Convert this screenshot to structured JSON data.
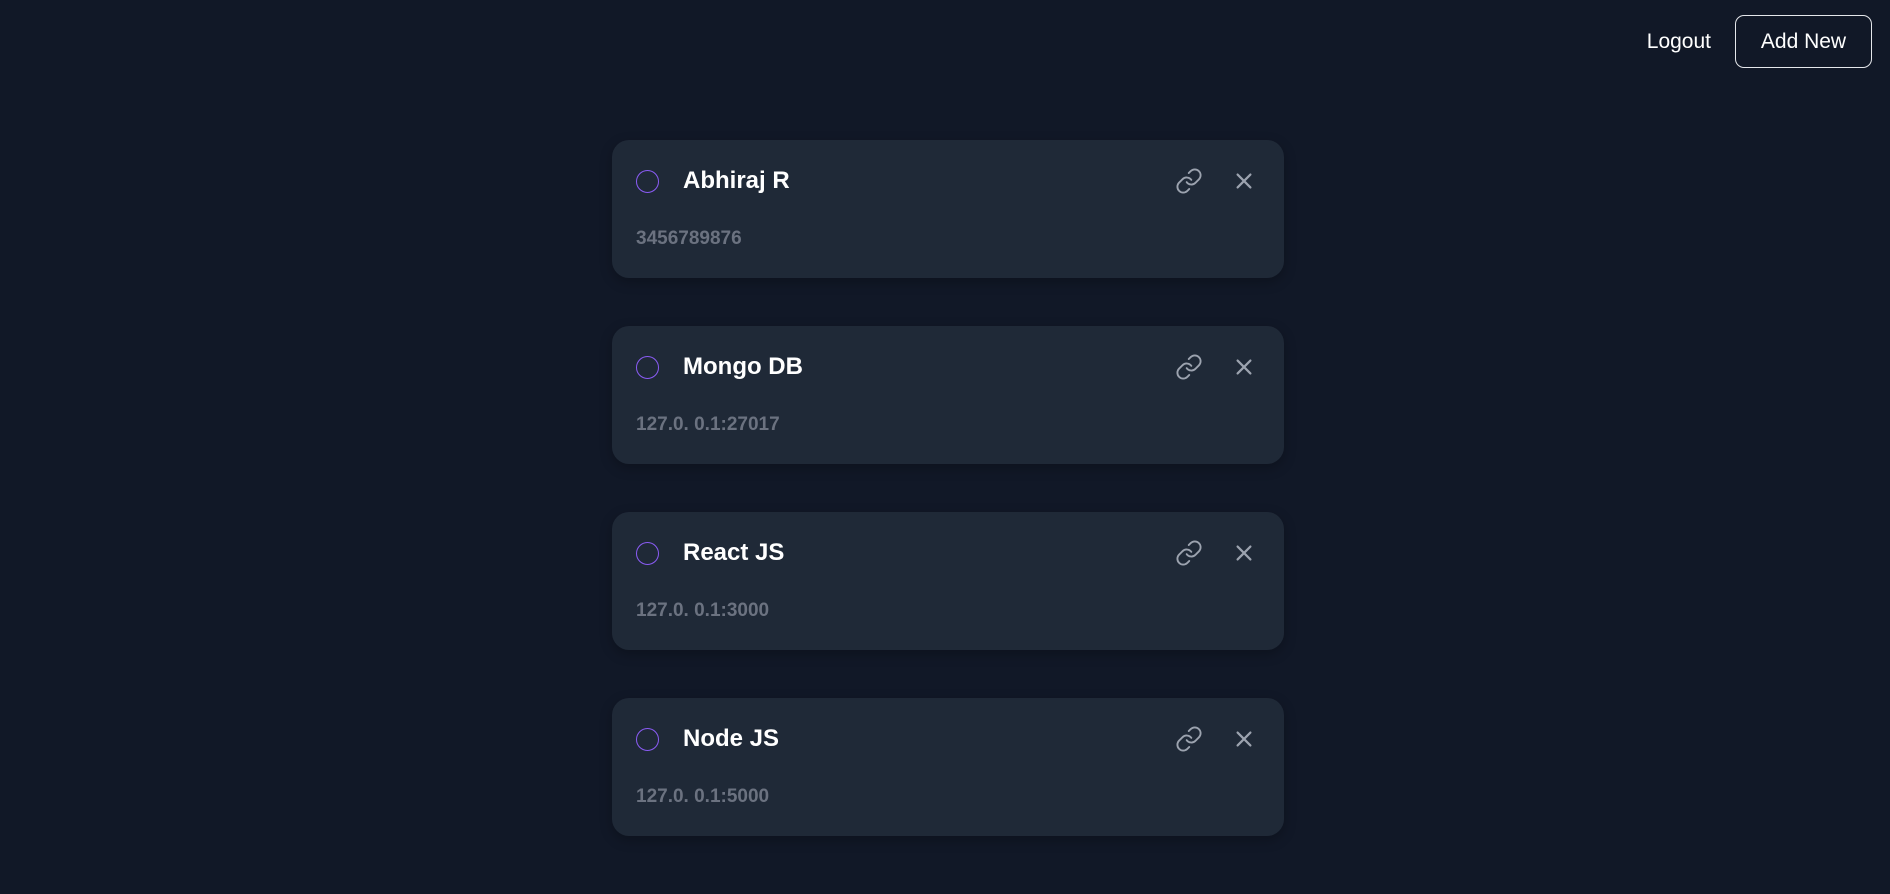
{
  "header": {
    "logout_label": "Logout",
    "add_new_label": "Add New"
  },
  "cards": [
    {
      "title": "Abhiraj R",
      "subtitle": "3456789876"
    },
    {
      "title": "Mongo DB",
      "subtitle": "127.0. 0.1:27017"
    },
    {
      "title": "React JS",
      "subtitle": "127.0. 0.1:3000"
    },
    {
      "title": "Node JS",
      "subtitle": "127.0. 0.1:5000"
    }
  ],
  "icons": {
    "link": "link-icon",
    "close": "close-icon"
  },
  "colors": {
    "background": "#111827",
    "card": "#1f2937",
    "accent": "#8b5cf6",
    "muted_text": "#6b7280",
    "icon": "#9ca3af"
  }
}
